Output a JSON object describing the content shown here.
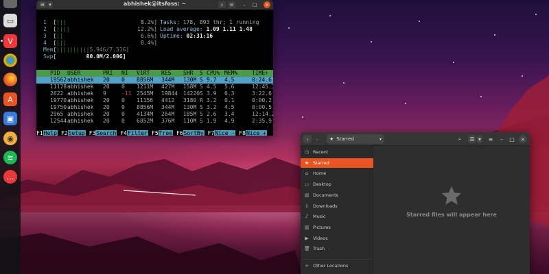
{
  "terminal": {
    "title": "abhishek@itsfoss: ~",
    "cpus": [
      {
        "num": "1",
        "pct": "8.2%]"
      },
      {
        "num": "2",
        "pct": "12.2%]"
      },
      {
        "num": "3",
        "pct": "6.6%]"
      },
      {
        "num": "4",
        "pct": "8.4%]"
      }
    ],
    "mem": {
      "label": "Mem",
      "value": "5.94G/7.51G]"
    },
    "swp": {
      "label": "Swp",
      "value": "80.0M/2.00G]"
    },
    "tasks_label": "Tasks:",
    "tasks_value": "178, 893 thr; 1 running",
    "load_label": "Load average:",
    "load_value": "1.09 1.11 1.48",
    "uptime_label": "Uptime:",
    "uptime_value": "02:31:16",
    "columns": [
      "PID",
      "USER",
      "PRI",
      "NI",
      "VIRT",
      "RES",
      "SHR",
      "S",
      "CPU%",
      "MEM%",
      "TIME+"
    ],
    "processes": [
      [
        "19562",
        "abhishek",
        "20",
        "0",
        "8856M",
        "344M",
        "130M",
        "S",
        "9.7",
        "4.5",
        "0:24.6"
      ],
      [
        "11178",
        "abhishek",
        "20",
        "0",
        "1211M",
        "427M",
        "158M",
        "S",
        "4.5",
        "5.6",
        "12:45.3"
      ],
      [
        "2622",
        "abhishek",
        "9",
        "-11",
        "2545M",
        "19844",
        "14220",
        "S",
        "3.9",
        "0.3",
        "3:22.6"
      ],
      [
        "19770",
        "abhishek",
        "20",
        "0",
        "11156",
        "4412",
        "3180",
        "R",
        "3.2",
        "0.1",
        "0:00.2"
      ],
      [
        "19750",
        "abhishek",
        "20",
        "0",
        "8856M",
        "344M",
        "130M",
        "S",
        "3.2",
        "4.5",
        "0:00.5"
      ],
      [
        "2965",
        "abhishek",
        "20",
        "0",
        "4134M",
        "264M",
        "105M",
        "S",
        "2.6",
        "3.4",
        "12:14.2"
      ],
      [
        "12544",
        "abhishek",
        "20",
        "0",
        "6852M",
        "376M",
        "110M",
        "S",
        "1.9",
        "4.9",
        "2:35.9"
      ]
    ],
    "fkeys": [
      {
        "key": "F1",
        "label": "Help"
      },
      {
        "key": "F2",
        "label": "Setup"
      },
      {
        "key": "F3",
        "label": "Search"
      },
      {
        "key": "F4",
        "label": "Filter"
      },
      {
        "key": "F5",
        "label": "Tree"
      },
      {
        "key": "F6",
        "label": "SortBy"
      },
      {
        "key": "F7",
        "label": "Nice -"
      },
      {
        "key": "F8",
        "label": "Nice +"
      }
    ]
  },
  "files": {
    "path": "Starred",
    "sidebar": [
      {
        "icon": "clock-icon",
        "label": "Recent"
      },
      {
        "icon": "star-icon",
        "label": "Starred"
      },
      {
        "icon": "home-icon",
        "label": "Home"
      },
      {
        "icon": "desktop-icon",
        "label": "Desktop"
      },
      {
        "icon": "document-icon",
        "label": "Documents"
      },
      {
        "icon": "download-icon",
        "label": "Downloads"
      },
      {
        "icon": "music-icon",
        "label": "Music"
      },
      {
        "icon": "picture-icon",
        "label": "Pictures"
      },
      {
        "icon": "video-icon",
        "label": "Videos"
      },
      {
        "icon": "trash-icon",
        "label": "Trash"
      }
    ],
    "other_locations": "Other Locations",
    "empty_message": "Starred files will appear here",
    "accent": "#e95420"
  },
  "dock": {
    "apps": [
      "files-icon",
      "vivaldi-icon",
      "chrome-icon",
      "firefox-icon",
      "app-store-icon",
      "screenshot-icon",
      "rhythmbox-icon",
      "spotify-icon",
      "chat-icon"
    ]
  }
}
